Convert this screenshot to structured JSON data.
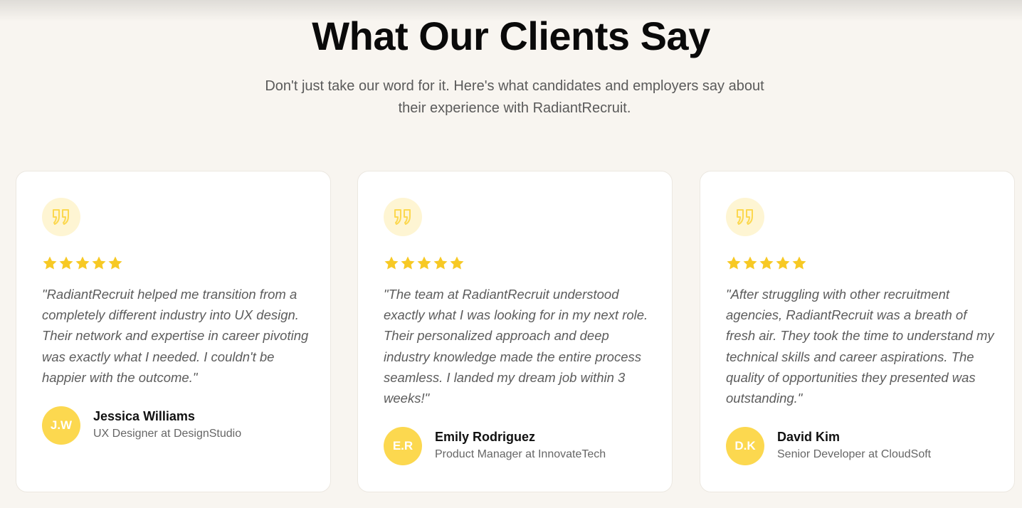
{
  "section": {
    "title": "What Our Clients Say",
    "subtitle": "Don't just take our word for it. Here's what candidates and employers say about their experience with RadiantRecruit."
  },
  "colors": {
    "background": "#f8f5f0",
    "star": "#f7c924",
    "avatar": "#fcd84f",
    "quote_badge": "#fef5d3",
    "quote_icon": "#fcd84f"
  },
  "icons": {
    "quote": "quote-icon",
    "star": "star-icon"
  },
  "testimonials": [
    {
      "rating": 5,
      "quote": "\"RadiantRecruit helped me transition from a completely different industry into UX design. Their network and expertise in career pivoting was exactly what I needed. I couldn't be happier with the outcome.\"",
      "initials": "J.W",
      "name": "Jessica Williams",
      "role": "UX Designer at DesignStudio"
    },
    {
      "rating": 5,
      "quote": "\"The team at RadiantRecruit understood exactly what I was looking for in my next role. Their personalized approach and deep industry knowledge made the entire process seamless. I landed my dream job within 3 weeks!\"",
      "initials": "E.R",
      "name": "Emily Rodriguez",
      "role": "Product Manager at InnovateTech"
    },
    {
      "rating": 5,
      "quote": "\"After struggling with other recruitment agencies, RadiantRecruit was a breath of fresh air. They took the time to understand my technical skills and career aspirations. The quality of opportunities they presented was outstanding.\"",
      "initials": "D.K",
      "name": "David Kim",
      "role": "Senior Developer at CloudSoft"
    }
  ]
}
